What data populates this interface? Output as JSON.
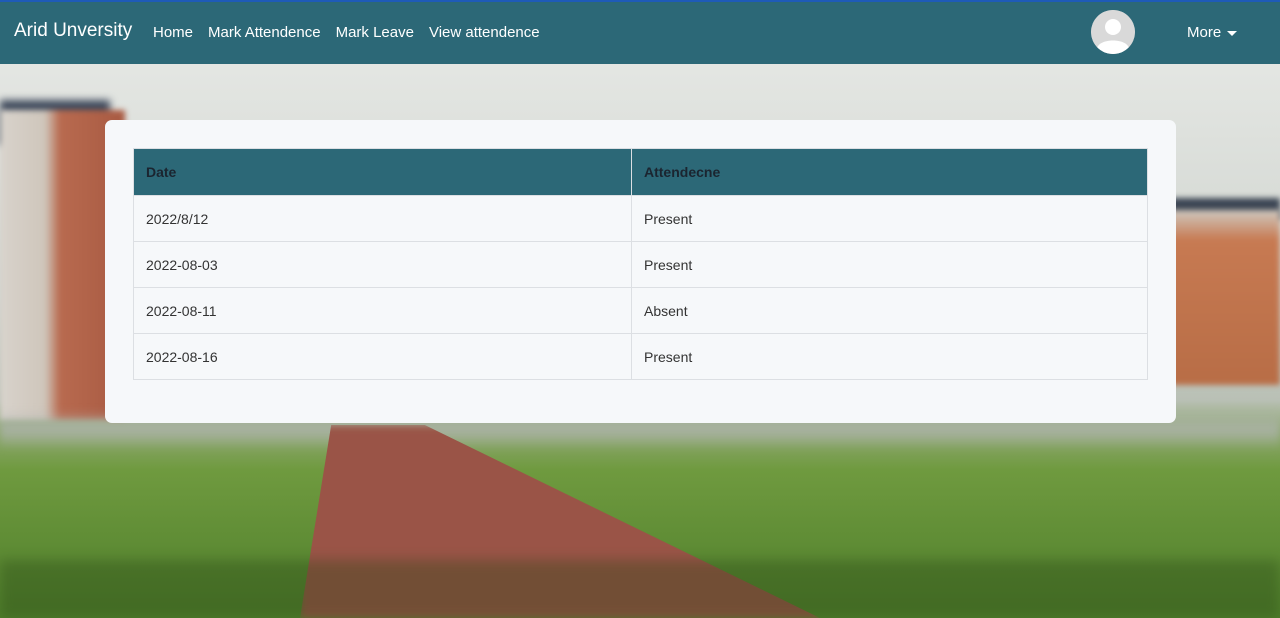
{
  "navbar": {
    "brand": "Arid Unversity",
    "links": [
      "Home",
      "Mark Attendence",
      "Mark Leave",
      "View attendence"
    ],
    "more_label": "More",
    "accent_color": "#2c6877"
  },
  "table": {
    "headers": [
      "Date",
      "Attendecne"
    ],
    "rows": [
      [
        "2022/8/12",
        "Present"
      ],
      [
        "2022-08-03",
        "Present"
      ],
      [
        "2022-08-11",
        "Absent"
      ],
      [
        "2022-08-16",
        "Present"
      ]
    ]
  },
  "icons": {
    "avatar": "user-avatar-icon",
    "caret": "caret-down-icon"
  }
}
